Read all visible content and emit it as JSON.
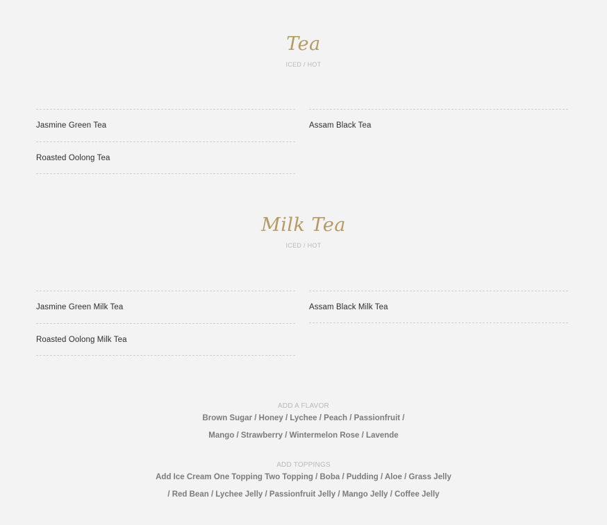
{
  "tea": {
    "title": "Tea",
    "subtitle": "ICED / HOT",
    "left": [
      "Jasmine Green Tea",
      "Roasted Oolong Tea"
    ],
    "right": [
      "Assam Black Tea"
    ]
  },
  "milk_tea": {
    "title": "Milk Tea",
    "subtitle": "ICED / HOT",
    "left": [
      "Jasmine Green Milk Tea",
      "Roasted Oolong Milk Tea"
    ],
    "right": [
      "Assam Black Milk Tea"
    ]
  },
  "flavor": {
    "label": "ADD A FLAVOR",
    "line1": "Brown Sugar / Honey / Lychee / Peach / Passionfruit /",
    "line2": "Mango / Strawberry / Wintermelon Rose / Lavende"
  },
  "toppings": {
    "label": "ADD TOPPINGS",
    "line1": "Add Ice Cream One Topping Two Topping / Boba / Pudding / Aloe / Grass Jelly",
    "line2": "/ Red Bean / Lychee Jelly / Passionfruit Jelly / Mango Jelly / Coffee Jelly"
  },
  "colors": {
    "accent": "#b59a62",
    "background": "#f3f3f3",
    "muted": "#b8b8b8"
  }
}
